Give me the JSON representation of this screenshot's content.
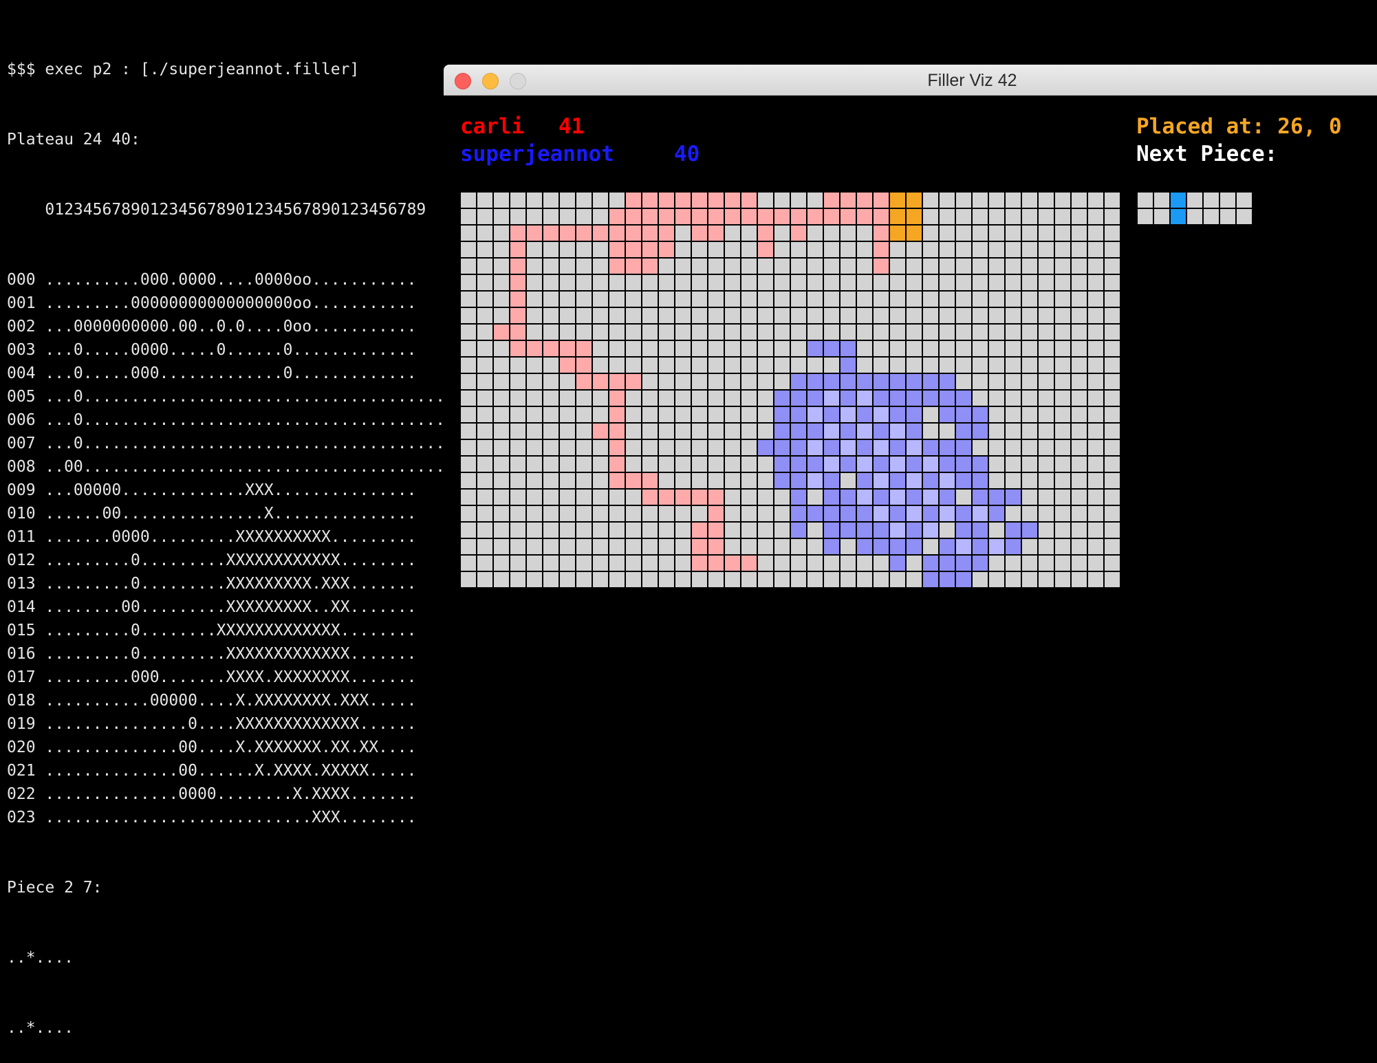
{
  "terminal": {
    "command": "$$$ exec p2 : [./superjeannot.filler]",
    "plateau_header": "Plateau 24 40:",
    "column_index": "    0123456789012345678901234567890123456789",
    "rows": [
      "000 ..........000.0000....0000oo...........",
      "001 .........00000000000000000oo...........",
      "002 ...0000000000.00..0.0....0oo...........",
      "003 ...0.....0000.....0......0.............",
      "004 ...0.....000.............0.............",
      "005 ...0.......................................",
      "006 ...0.......................................",
      "007 ...0.......................................",
      "008 ..00.......................................",
      "009 ...00000.............XXX...............",
      "010 ......00...............X...............",
      "011 .......0000.........XXXXXXXXXX.........",
      "012 .........0.........XXXXXXXXXXXX........",
      "013 .........0.........XXXXXXXXX.XXX.......",
      "014 ........00.........XXXXXXXXX..XX.......",
      "015 .........0........XXXXXXXXXXXXX........",
      "016 .........0.........XXXXXXXXXXXXX.......",
      "017 .........000.......XXXX.XXXXXXXX.......",
      "018 ...........00000....X.XXXXXXXX.XXX.....",
      "019 ...............0....XXXXXXXXXXXXX......",
      "020 ..............00....X.XXXXXXX.XX.XX....",
      "021 ..............00......X.XXXX.XXXXX.....",
      "022 ..............0000........X.XXXX.......",
      "023 ............................XXX........"
    ],
    "piece_header": "Piece 2 7:",
    "piece_rows": [
      "..*....",
      "..*...."
    ]
  },
  "window": {
    "title": "Filler Viz 42"
  },
  "players": {
    "p1": {
      "name": "carli",
      "score": "41",
      "color": "#ff0000"
    },
    "p2": {
      "name": "superjeannot",
      "score": "40",
      "color": "#1a1aff"
    }
  },
  "status": {
    "placed": "Placed at: 26, 0",
    "placed_color": "#f5a623",
    "next_piece_label": "Next Piece:"
  },
  "board": {
    "rows": 24,
    "cols": 40,
    "empty_color": "#d3d3d3",
    "p1_color": "#ffaaaa",
    "p1_recent_color": "#f59797",
    "p2_color": "#8f8ff5",
    "p2_light_color": "#b7b7ff",
    "last_piece_color": "#f5a623",
    "p1_cells": [
      [
        0,
        10
      ],
      [
        0,
        11
      ],
      [
        0,
        12
      ],
      [
        0,
        13
      ],
      [
        0,
        14
      ],
      [
        0,
        15
      ],
      [
        0,
        16
      ],
      [
        0,
        17
      ],
      [
        0,
        22
      ],
      [
        0,
        23
      ],
      [
        0,
        24
      ],
      [
        0,
        25
      ],
      [
        1,
        9
      ],
      [
        1,
        10
      ],
      [
        1,
        11
      ],
      [
        1,
        12
      ],
      [
        1,
        13
      ],
      [
        1,
        14
      ],
      [
        1,
        15
      ],
      [
        1,
        16
      ],
      [
        1,
        17
      ],
      [
        1,
        18
      ],
      [
        1,
        19
      ],
      [
        1,
        20
      ],
      [
        1,
        21
      ],
      [
        1,
        22
      ],
      [
        1,
        23
      ],
      [
        1,
        24
      ],
      [
        1,
        25
      ],
      [
        2,
        3
      ],
      [
        2,
        4
      ],
      [
        2,
        5
      ],
      [
        2,
        6
      ],
      [
        2,
        7
      ],
      [
        2,
        8
      ],
      [
        2,
        9
      ],
      [
        2,
        10
      ],
      [
        2,
        11
      ],
      [
        2,
        12
      ],
      [
        2,
        14
      ],
      [
        2,
        15
      ],
      [
        2,
        18
      ],
      [
        2,
        20
      ],
      [
        2,
        25
      ],
      [
        3,
        3
      ],
      [
        3,
        9
      ],
      [
        3,
        10
      ],
      [
        3,
        11
      ],
      [
        3,
        12
      ],
      [
        3,
        18
      ],
      [
        3,
        25
      ],
      [
        4,
        3
      ],
      [
        4,
        9
      ],
      [
        4,
        10
      ],
      [
        4,
        11
      ],
      [
        4,
        25
      ],
      [
        5,
        3
      ],
      [
        6,
        3
      ],
      [
        7,
        3
      ],
      [
        8,
        2
      ],
      [
        8,
        3
      ],
      [
        9,
        3
      ],
      [
        9,
        4
      ],
      [
        9,
        5
      ],
      [
        9,
        6
      ],
      [
        9,
        7
      ],
      [
        10,
        6
      ],
      [
        10,
        7
      ],
      [
        11,
        7
      ],
      [
        11,
        8
      ],
      [
        11,
        9
      ],
      [
        11,
        10
      ],
      [
        12,
        9
      ],
      [
        13,
        9
      ],
      [
        14,
        8
      ],
      [
        14,
        9
      ],
      [
        15,
        9
      ],
      [
        16,
        9
      ],
      [
        17,
        9
      ],
      [
        17,
        10
      ],
      [
        17,
        11
      ],
      [
        18,
        11
      ],
      [
        18,
        12
      ],
      [
        18,
        13
      ],
      [
        18,
        14
      ],
      [
        18,
        15
      ],
      [
        19,
        15
      ],
      [
        20,
        14
      ],
      [
        20,
        15
      ],
      [
        21,
        14
      ],
      [
        21,
        15
      ],
      [
        22,
        14
      ],
      [
        22,
        15
      ],
      [
        22,
        16
      ],
      [
        22,
        17
      ]
    ],
    "p2_cells": [
      [
        9,
        21
      ],
      [
        9,
        22
      ],
      [
        9,
        23
      ],
      [
        10,
        23
      ],
      [
        11,
        20
      ],
      [
        11,
        21
      ],
      [
        11,
        22
      ],
      [
        11,
        23
      ],
      [
        11,
        24
      ],
      [
        11,
        25
      ],
      [
        11,
        26
      ],
      [
        11,
        27
      ],
      [
        11,
        28
      ],
      [
        11,
        29
      ],
      [
        12,
        19
      ],
      [
        12,
        20
      ],
      [
        12,
        21
      ],
      [
        12,
        22
      ],
      [
        12,
        23
      ],
      [
        12,
        24
      ],
      [
        12,
        25
      ],
      [
        12,
        26
      ],
      [
        12,
        27
      ],
      [
        12,
        28
      ],
      [
        12,
        29
      ],
      [
        12,
        30
      ],
      [
        13,
        19
      ],
      [
        13,
        20
      ],
      [
        13,
        21
      ],
      [
        13,
        22
      ],
      [
        13,
        23
      ],
      [
        13,
        24
      ],
      [
        13,
        25
      ],
      [
        13,
        26
      ],
      [
        13,
        27
      ],
      [
        13,
        29
      ],
      [
        13,
        30
      ],
      [
        13,
        31
      ],
      [
        14,
        19
      ],
      [
        14,
        20
      ],
      [
        14,
        21
      ],
      [
        14,
        22
      ],
      [
        14,
        23
      ],
      [
        14,
        24
      ],
      [
        14,
        25
      ],
      [
        14,
        26
      ],
      [
        14,
        27
      ],
      [
        14,
        30
      ],
      [
        14,
        31
      ],
      [
        15,
        18
      ],
      [
        15,
        19
      ],
      [
        15,
        20
      ],
      [
        15,
        21
      ],
      [
        15,
        22
      ],
      [
        15,
        23
      ],
      [
        15,
        24
      ],
      [
        15,
        25
      ],
      [
        15,
        26
      ],
      [
        15,
        27
      ],
      [
        15,
        28
      ],
      [
        15,
        29
      ],
      [
        15,
        30
      ],
      [
        16,
        19
      ],
      [
        16,
        20
      ],
      [
        16,
        21
      ],
      [
        16,
        22
      ],
      [
        16,
        23
      ],
      [
        16,
        24
      ],
      [
        16,
        25
      ],
      [
        16,
        26
      ],
      [
        16,
        27
      ],
      [
        16,
        28
      ],
      [
        16,
        29
      ],
      [
        16,
        30
      ],
      [
        16,
        31
      ],
      [
        17,
        19
      ],
      [
        17,
        20
      ],
      [
        17,
        21
      ],
      [
        17,
        22
      ],
      [
        17,
        24
      ],
      [
        17,
        25
      ],
      [
        17,
        26
      ],
      [
        17,
        27
      ],
      [
        17,
        28
      ],
      [
        17,
        29
      ],
      [
        17,
        30
      ],
      [
        17,
        31
      ],
      [
        18,
        20
      ],
      [
        18,
        22
      ],
      [
        18,
        23
      ],
      [
        18,
        24
      ],
      [
        18,
        25
      ],
      [
        18,
        26
      ],
      [
        18,
        27
      ],
      [
        18,
        28
      ],
      [
        18,
        29
      ],
      [
        18,
        31
      ],
      [
        18,
        32
      ],
      [
        18,
        33
      ],
      [
        19,
        20
      ],
      [
        19,
        21
      ],
      [
        19,
        22
      ],
      [
        19,
        23
      ],
      [
        19,
        24
      ],
      [
        19,
        25
      ],
      [
        19,
        26
      ],
      [
        19,
        27
      ],
      [
        19,
        28
      ],
      [
        19,
        29
      ],
      [
        19,
        30
      ],
      [
        19,
        31
      ],
      [
        19,
        32
      ],
      [
        20,
        20
      ],
      [
        20,
        22
      ],
      [
        20,
        23
      ],
      [
        20,
        24
      ],
      [
        20,
        25
      ],
      [
        20,
        26
      ],
      [
        20,
        27
      ],
      [
        20,
        28
      ],
      [
        20,
        30
      ],
      [
        20,
        31
      ],
      [
        20,
        33
      ],
      [
        20,
        34
      ],
      [
        21,
        22
      ],
      [
        21,
        24
      ],
      [
        21,
        25
      ],
      [
        21,
        26
      ],
      [
        21,
        27
      ],
      [
        21,
        29
      ],
      [
        21,
        30
      ],
      [
        21,
        31
      ],
      [
        21,
        32
      ],
      [
        21,
        33
      ],
      [
        22,
        26
      ],
      [
        22,
        28
      ],
      [
        22,
        29
      ],
      [
        22,
        30
      ],
      [
        22,
        31
      ],
      [
        23,
        28
      ],
      [
        23,
        29
      ],
      [
        23,
        30
      ]
    ],
    "p2_light_cells": [
      [
        12,
        22
      ],
      [
        12,
        24
      ],
      [
        13,
        21
      ],
      [
        13,
        23
      ],
      [
        13,
        25
      ],
      [
        14,
        22
      ],
      [
        14,
        24
      ],
      [
        14,
        26
      ],
      [
        15,
        21
      ],
      [
        15,
        23
      ],
      [
        15,
        25
      ],
      [
        15,
        27
      ],
      [
        16,
        22
      ],
      [
        16,
        24
      ],
      [
        16,
        26
      ],
      [
        16,
        28
      ],
      [
        17,
        21
      ],
      [
        17,
        25
      ],
      [
        17,
        27
      ],
      [
        17,
        29
      ],
      [
        18,
        24
      ],
      [
        18,
        26
      ],
      [
        18,
        28
      ],
      [
        19,
        25
      ],
      [
        19,
        27
      ],
      [
        19,
        29
      ],
      [
        19,
        31
      ],
      [
        20,
        26
      ],
      [
        20,
        28
      ],
      [
        21,
        30
      ],
      [
        21,
        32
      ]
    ],
    "last_piece_cells": [
      [
        0,
        26
      ],
      [
        0,
        27
      ],
      [
        1,
        26
      ],
      [
        1,
        27
      ],
      [
        2,
        26
      ],
      [
        2,
        27
      ]
    ]
  },
  "next_piece": {
    "rows": 2,
    "cols": 7,
    "empty_color": "#d3d3d3",
    "fill_color": "#1a9af5",
    "cells": [
      [
        0,
        2
      ],
      [
        1,
        2
      ]
    ]
  }
}
